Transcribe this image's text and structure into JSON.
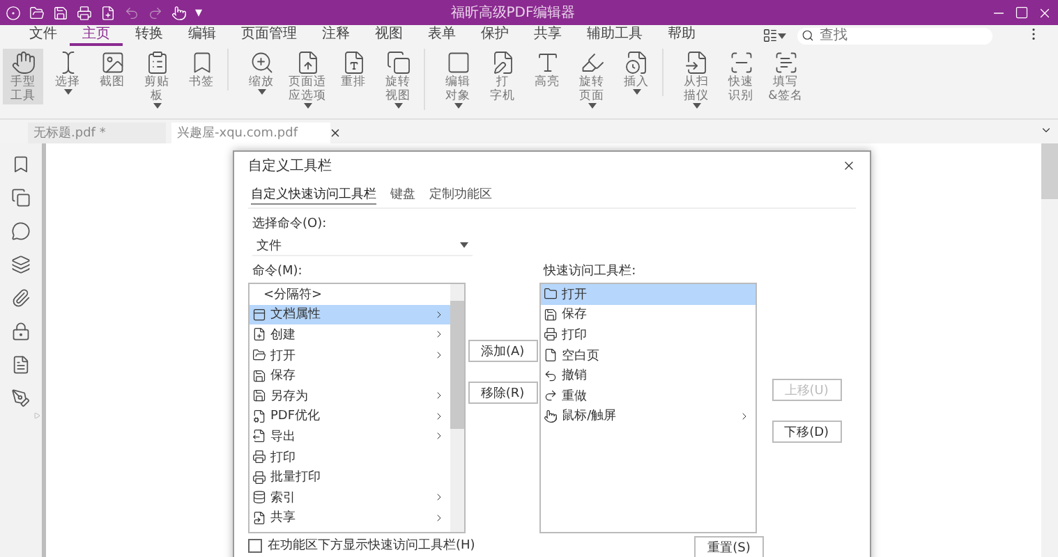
{
  "window": {
    "title": "福昕高级PDF编辑器"
  },
  "quick_access": {
    "customize": "▾"
  },
  "menu": [
    {
      "label": "文件",
      "selected": false
    },
    {
      "label": "主页",
      "selected": true
    },
    {
      "label": "转换",
      "selected": false
    },
    {
      "label": "编辑",
      "selected": false
    },
    {
      "label": "页面管理",
      "selected": false
    },
    {
      "label": "注释",
      "selected": false
    },
    {
      "label": "视图",
      "selected": false
    },
    {
      "label": "表单",
      "selected": false
    },
    {
      "label": "保护",
      "selected": false
    },
    {
      "label": "共享",
      "selected": false
    },
    {
      "label": "辅助工具",
      "selected": false
    },
    {
      "label": "帮助",
      "selected": false
    }
  ],
  "search": {
    "placeholder": "查找"
  },
  "ribbon": [
    {
      "lines": [
        "手型",
        "工具"
      ],
      "selected": true,
      "dropdown": false,
      "group_end": false
    },
    {
      "lines": [
        "选择"
      ],
      "selected": false,
      "dropdown": true,
      "group_end": false
    },
    {
      "lines": [
        "截图"
      ],
      "selected": false,
      "dropdown": false,
      "group_end": false
    },
    {
      "lines": [
        "剪贴",
        "板"
      ],
      "selected": false,
      "dropdown": true,
      "group_end": false
    },
    {
      "lines": [
        "书签"
      ],
      "selected": false,
      "dropdown": false,
      "group_end": true
    },
    {
      "lines": [
        "缩放"
      ],
      "selected": false,
      "dropdown": true,
      "group_end": false
    },
    {
      "lines": [
        "页面适",
        "应选项"
      ],
      "selected": false,
      "dropdown": true,
      "group_end": false
    },
    {
      "lines": [
        "重排"
      ],
      "selected": false,
      "dropdown": false,
      "group_end": false
    },
    {
      "lines": [
        "旋转",
        "视图"
      ],
      "selected": false,
      "dropdown": true,
      "group_end": true
    },
    {
      "lines": [
        "编辑",
        "对象"
      ],
      "selected": false,
      "dropdown": true,
      "group_end": false
    },
    {
      "lines": [
        "打",
        "字机"
      ],
      "selected": false,
      "dropdown": false,
      "group_end": false
    },
    {
      "lines": [
        "高亮"
      ],
      "selected": false,
      "dropdown": false,
      "group_end": false
    },
    {
      "lines": [
        "旋转",
        "页面"
      ],
      "selected": false,
      "dropdown": true,
      "group_end": false
    },
    {
      "lines": [
        "插入"
      ],
      "selected": false,
      "dropdown": true,
      "group_end": true
    },
    {
      "lines": [
        "从扫",
        "描仪"
      ],
      "selected": false,
      "dropdown": true,
      "group_end": false
    },
    {
      "lines": [
        "快速",
        "识别"
      ],
      "selected": false,
      "dropdown": false,
      "group_end": false
    },
    {
      "lines": [
        "填写",
        "&签名"
      ],
      "selected": false,
      "dropdown": false,
      "group_end": false
    }
  ],
  "doc_tabs": [
    {
      "label": "无标题.pdf *",
      "selected": false,
      "closable": false
    },
    {
      "label": "兴趣屋-xqu.com.pdf",
      "selected": true,
      "closable": true
    }
  ],
  "dialog": {
    "title": "自定义工具栏",
    "tabs": [
      {
        "label": "自定义快速访问工具栏",
        "selected": true
      },
      {
        "label": "键盘",
        "selected": false
      },
      {
        "label": "定制功能区",
        "selected": false
      }
    ],
    "choose_label": "选择命令(O):",
    "choose_value": "文件",
    "commands_label": "命令(M):",
    "toolbar_label": "快速访问工具栏:",
    "commands": [
      {
        "label": "<分隔符>",
        "selected": false,
        "submenu": false,
        "icon": false
      },
      {
        "label": "文档属性",
        "selected": true,
        "submenu": true,
        "icon": true
      },
      {
        "label": "创建",
        "selected": false,
        "submenu": true,
        "icon": true
      },
      {
        "label": "打开",
        "selected": false,
        "submenu": true,
        "icon": true
      },
      {
        "label": "保存",
        "selected": false,
        "submenu": false,
        "icon": true
      },
      {
        "label": "另存为",
        "selected": false,
        "submenu": true,
        "icon": true
      },
      {
        "label": "PDF优化",
        "selected": false,
        "submenu": true,
        "icon": true
      },
      {
        "label": "导出",
        "selected": false,
        "submenu": true,
        "icon": true
      },
      {
        "label": "打印",
        "selected": false,
        "submenu": false,
        "icon": true
      },
      {
        "label": "批量打印",
        "selected": false,
        "submenu": false,
        "icon": true
      },
      {
        "label": "索引",
        "selected": false,
        "submenu": true,
        "icon": true
      },
      {
        "label": "共享",
        "selected": false,
        "submenu": true,
        "icon": true
      }
    ],
    "toolbar_items": [
      {
        "label": "打开",
        "selected": true,
        "submenu": false
      },
      {
        "label": "保存",
        "selected": false,
        "submenu": false
      },
      {
        "label": "打印",
        "selected": false,
        "submenu": false
      },
      {
        "label": "空白页",
        "selected": false,
        "submenu": false
      },
      {
        "label": "撤销",
        "selected": false,
        "submenu": false
      },
      {
        "label": "重做",
        "selected": false,
        "submenu": false
      },
      {
        "label": "鼠标/触屏",
        "selected": false,
        "submenu": true
      }
    ],
    "add_button": {
      "label": "添加(A)",
      "disabled": false
    },
    "remove_button": {
      "label": "移除(R)",
      "disabled": false
    },
    "up_button": {
      "label": "上移(U)",
      "disabled": true
    },
    "down_button": {
      "label": "下移(D)",
      "disabled": false
    },
    "reset_button": {
      "label": "重置(S)",
      "disabled": false
    },
    "show_below": {
      "label": "在功能区下方显示快速访问工具栏(H)",
      "checked": false
    }
  }
}
